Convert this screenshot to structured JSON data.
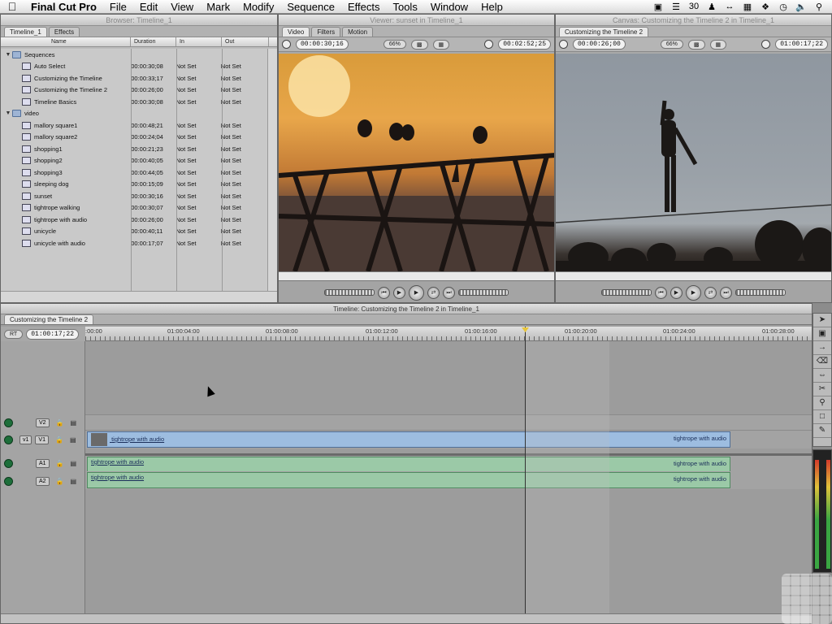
{
  "menubar": {
    "app": "Final Cut Pro",
    "menus": [
      "File",
      "Edit",
      "View",
      "Mark",
      "Modify",
      "Sequence",
      "Effects",
      "Tools",
      "Window",
      "Help"
    ],
    "status_30": "30"
  },
  "browser": {
    "title": "Browser: Timeline_1",
    "tabs": [
      "Timeline_1",
      "Effects"
    ],
    "columns": [
      "Name",
      "Duration",
      "In",
      "Out"
    ],
    "rows": [
      {
        "name": "Sequences",
        "duration": "",
        "in": "",
        "out": "",
        "folder": true,
        "level": 0
      },
      {
        "name": "Auto Select",
        "duration": "00:00:30;08",
        "in": "Not Set",
        "out": "Not Set",
        "folder": false,
        "level": 1
      },
      {
        "name": "Customizing the Timeline",
        "duration": "00:00:33;17",
        "in": "Not Set",
        "out": "Not Set",
        "folder": false,
        "level": 1
      },
      {
        "name": "Customizing the Timeline 2",
        "duration": "00:00:26;00",
        "in": "Not Set",
        "out": "Not Set",
        "folder": false,
        "level": 1
      },
      {
        "name": "Timeline Basics",
        "duration": "00:00:30;08",
        "in": "Not Set",
        "out": "Not Set",
        "folder": false,
        "level": 1
      },
      {
        "name": "video",
        "duration": "",
        "in": "",
        "out": "",
        "folder": true,
        "level": 0
      },
      {
        "name": "mallory square1",
        "duration": "00:00:48;21",
        "in": "Not Set",
        "out": "Not Set",
        "folder": false,
        "level": 1
      },
      {
        "name": "mallory square2",
        "duration": "00:00:24;04",
        "in": "Not Set",
        "out": "Not Set",
        "folder": false,
        "level": 1
      },
      {
        "name": "shopping1",
        "duration": "00:00:21;23",
        "in": "Not Set",
        "out": "Not Set",
        "folder": false,
        "level": 1
      },
      {
        "name": "shopping2",
        "duration": "00:00:40;05",
        "in": "Not Set",
        "out": "Not Set",
        "folder": false,
        "level": 1
      },
      {
        "name": "shopping3",
        "duration": "00:00:44;05",
        "in": "Not Set",
        "out": "Not Set",
        "folder": false,
        "level": 1
      },
      {
        "name": "sleeping dog",
        "duration": "00:00:15;09",
        "in": "Not Set",
        "out": "Not Set",
        "folder": false,
        "level": 1
      },
      {
        "name": "sunset",
        "duration": "00:00:30;16",
        "in": "Not Set",
        "out": "Not Set",
        "folder": false,
        "level": 1
      },
      {
        "name": "tightrope walking",
        "duration": "00:00:30;07",
        "in": "Not Set",
        "out": "Not Set",
        "folder": false,
        "level": 1
      },
      {
        "name": "tightrope with audio",
        "duration": "00:00:26;00",
        "in": "Not Set",
        "out": "Not Set",
        "folder": false,
        "level": 1
      },
      {
        "name": "unicycle",
        "duration": "00:00:40;11",
        "in": "Not Set",
        "out": "Not Set",
        "folder": false,
        "level": 1
      },
      {
        "name": "unicycle with audio",
        "duration": "00:00:17;07",
        "in": "Not Set",
        "out": "Not Set",
        "folder": false,
        "level": 1
      }
    ]
  },
  "viewer": {
    "title": "Viewer: sunset in Timeline_1",
    "tabs": [
      "Video",
      "Filters",
      "Motion"
    ],
    "timecode_left": "00:00:30;16",
    "zoom": "66%",
    "timecode_right": "00:02:52;25"
  },
  "canvas": {
    "title": "Canvas: Customizing the Timeline 2 in Timeline_1",
    "tab": "Customizing the Timeline 2",
    "timecode_left": "00:00:26;00",
    "zoom": "66%",
    "timecode_right": "01:00:17;22"
  },
  "timeline": {
    "title": "Timeline: Customizing the Timeline 2 in Timeline_1",
    "tab": "Customizing the Timeline 2",
    "rt": "RT",
    "current_time": "01:00:17;22",
    "ruler": [
      ":00:00",
      "01:00:04:00",
      "01:00:08:00",
      "01:00:12:00",
      "01:00:16:00",
      "01:00:20:00",
      "01:00:24:00",
      "01:00:28:00"
    ],
    "tracks": {
      "v2": "V2",
      "v1_src": "v1",
      "v1": "V1",
      "a1": "A1",
      "a2": "A2"
    },
    "clips": {
      "v1": "tightrope with audio",
      "a1": "tightrope with audio",
      "a2": "tightrope with audio"
    }
  }
}
